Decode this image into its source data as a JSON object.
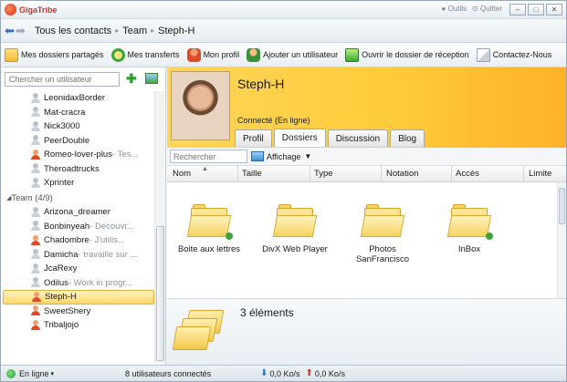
{
  "app": {
    "name": "GigaTribe",
    "menu_tools": "Outils",
    "menu_quit": "Quitter"
  },
  "nav": {
    "breadcrumb": [
      "Tous les contacts",
      "Team",
      "Steph-H"
    ]
  },
  "toolbar": {
    "items": [
      {
        "label": "Mes dossiers partagés",
        "icon": "shared-folders-icon"
      },
      {
        "label": "Mes transferts",
        "icon": "transfers-icon"
      },
      {
        "label": "Mon profil",
        "icon": "profile-icon"
      },
      {
        "label": "Ajouter un utilisateur",
        "icon": "add-user-icon"
      },
      {
        "label": "Ouvrir le dossier de réception",
        "icon": "open-folder-icon"
      },
      {
        "label": "Contactez-Nous",
        "icon": "contact-icon"
      }
    ]
  },
  "sidebar": {
    "search_placeholder": "Chercher un utilisateur",
    "users_top": [
      {
        "name": "LeonidaxBorder",
        "status": "",
        "avatar": "grey"
      },
      {
        "name": "Mat-cracra",
        "status": "",
        "avatar": "grey"
      },
      {
        "name": "Nick3000",
        "status": "",
        "avatar": "grey"
      },
      {
        "name": "PeerDouble",
        "status": "",
        "avatar": "grey"
      },
      {
        "name": "Romeo-lover-plus",
        "status": " - Tes...",
        "avatar": "red"
      },
      {
        "name": "Theroadtrucks",
        "status": "",
        "avatar": "grey"
      },
      {
        "name": "Xprinter",
        "status": "",
        "avatar": "grey"
      }
    ],
    "group_label": "Team (4/9)",
    "users_team": [
      {
        "name": "Arizona_dreamer",
        "status": "",
        "avatar": "grey"
      },
      {
        "name": "Bonbinyeah",
        "status": " - Découvr...",
        "avatar": "grey"
      },
      {
        "name": "Chadombre",
        "status": " - J'utilis...",
        "avatar": "red"
      },
      {
        "name": "Damicha",
        "status": " - travaille sur ...",
        "avatar": "grey"
      },
      {
        "name": "JcaRexy",
        "status": "",
        "avatar": "grey"
      },
      {
        "name": "Odilus",
        "status": " - Work in progr...",
        "avatar": "grey"
      },
      {
        "name": "Steph-H",
        "status": "",
        "avatar": "red"
      },
      {
        "name": "SweetShery",
        "status": "",
        "avatar": "red"
      },
      {
        "name": "Tribaljojo",
        "status": "",
        "avatar": "red"
      }
    ]
  },
  "profile": {
    "name": "Steph-H",
    "status": "Connecté (En ligne)",
    "tabs": [
      "Profil",
      "Dossiers",
      "Discussion",
      "Blog"
    ],
    "active_tab": "Dossiers"
  },
  "files_panel": {
    "search_placeholder": "Rechercher",
    "view_label": "Affichage",
    "columns": [
      "Nom",
      "Taille",
      "Type",
      "Notation",
      "Accès",
      "Limite"
    ],
    "folders": [
      {
        "name": "Boite aux lettres",
        "shared": true
      },
      {
        "name": "DivX Web Player",
        "shared": false
      },
      {
        "name": "Photos SanFrancisco",
        "shared": false
      },
      {
        "name": "InBox",
        "shared": true
      }
    ],
    "summary": "3 éléments"
  },
  "statusbar": {
    "online": "En ligne",
    "connected_users": "8 utilisateurs connectés",
    "download_rate": "0,0 Ko/s",
    "upload_rate": "0,0 Ko/s"
  },
  "colors": {
    "profile_header": "#ffcc3a",
    "selection": "#ffd86a",
    "folder": "#f2c84a",
    "accent_blue": "#3b6fb3"
  }
}
